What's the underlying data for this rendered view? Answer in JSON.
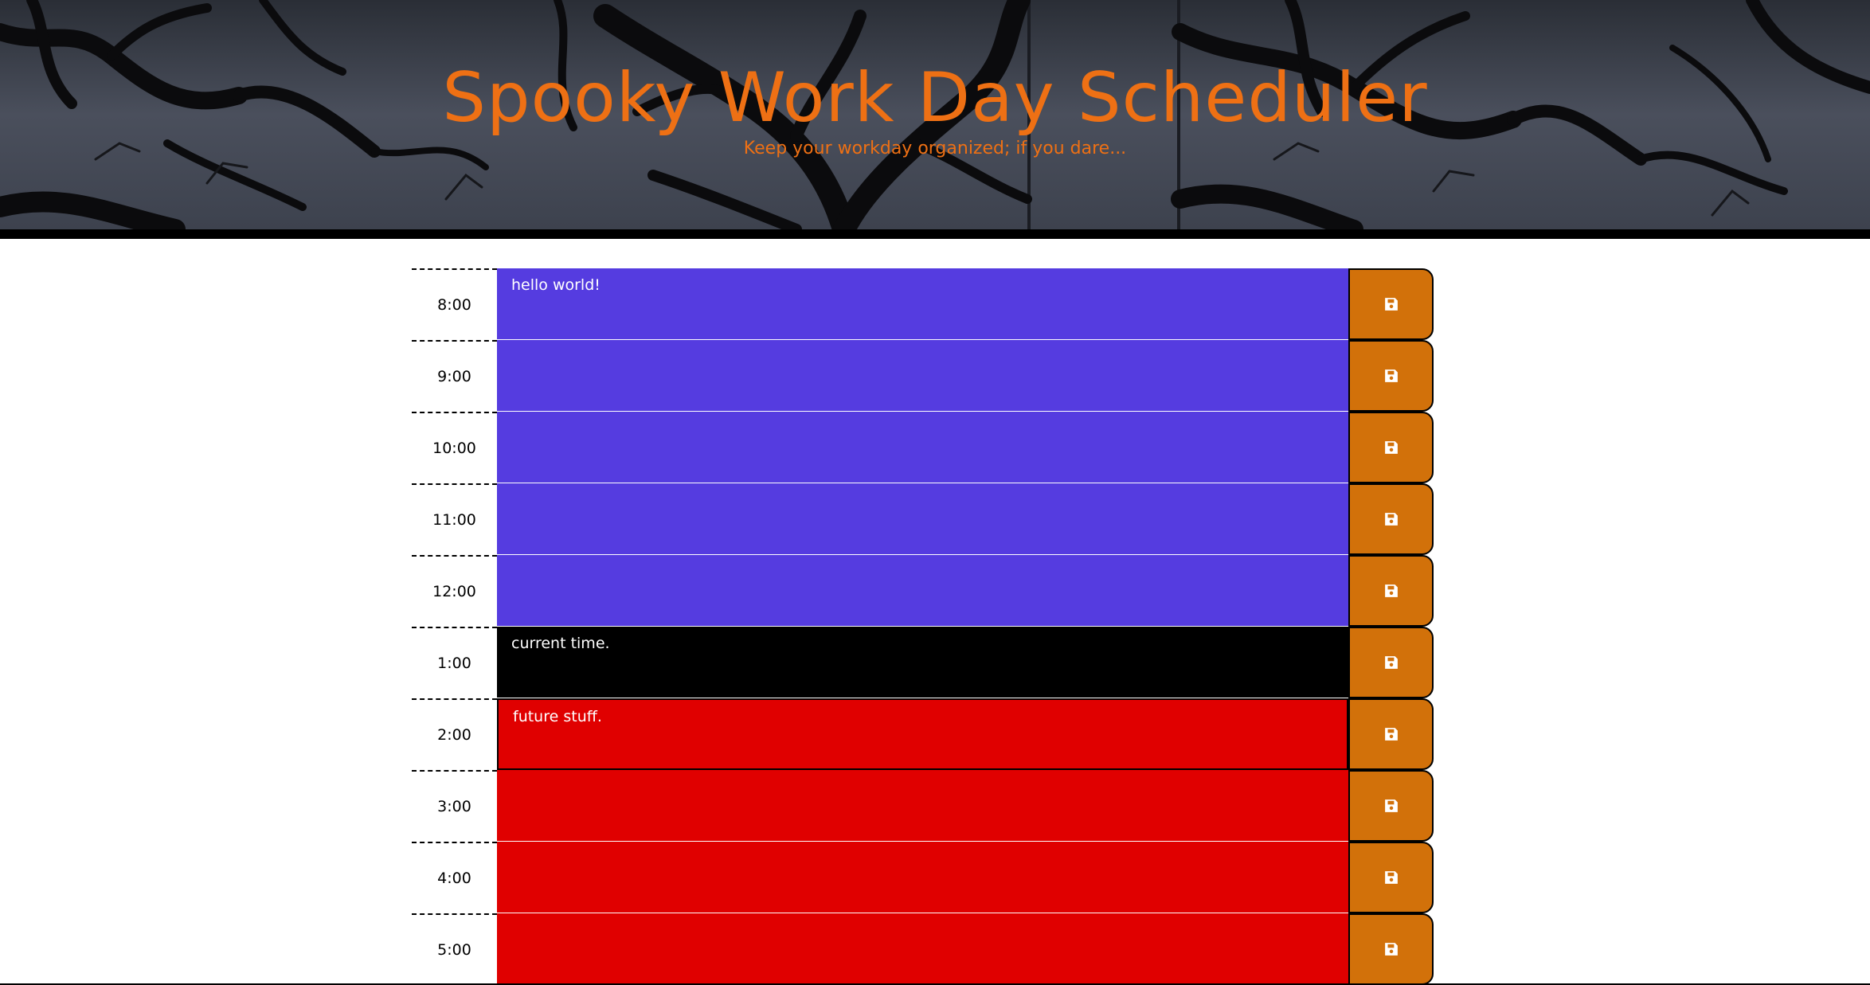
{
  "header": {
    "title": "Spooky Work Day Scheduler",
    "lead": "Keep your workday organized; if you dare..."
  },
  "colors": {
    "title": "#ee7014",
    "past": "#553ce0",
    "present": "#000000",
    "future": "#e00000",
    "save_button": "#d2710a"
  },
  "icons": {
    "save": "floppy-disk-icon"
  },
  "schedule": [
    {
      "hour": "8:00",
      "text": "hello world!",
      "state": "past"
    },
    {
      "hour": "9:00",
      "text": "",
      "state": "past"
    },
    {
      "hour": "10:00",
      "text": "",
      "state": "past"
    },
    {
      "hour": "11:00",
      "text": "",
      "state": "past"
    },
    {
      "hour": "12:00",
      "text": "",
      "state": "past"
    },
    {
      "hour": "1:00",
      "text": "current time.",
      "state": "present"
    },
    {
      "hour": "2:00",
      "text": "future stuff.",
      "state": "future"
    },
    {
      "hour": "3:00",
      "text": "",
      "state": "future"
    },
    {
      "hour": "4:00",
      "text": "",
      "state": "future"
    },
    {
      "hour": "5:00",
      "text": "",
      "state": "future"
    }
  ]
}
